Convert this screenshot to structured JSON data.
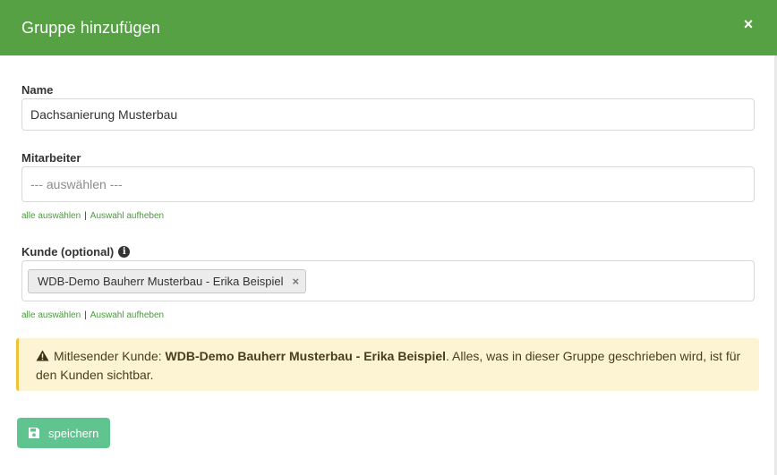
{
  "modal": {
    "title": "Gruppe hinzufügen",
    "close_symbol": "×"
  },
  "form": {
    "name": {
      "label": "Name",
      "value": "Dachsanierung Musterbau"
    },
    "mitarbeiter": {
      "label": "Mitarbeiter",
      "placeholder": "--- auswählen ---",
      "select_all": "alle auswählen",
      "separator": "|",
      "deselect": "Auswahl aufheben"
    },
    "kunde": {
      "label": "Kunde (optional)",
      "info_symbol": "i",
      "selected_tag": "WDB-Demo Bauherr Musterbau - Erika Beispiel",
      "tag_remove_symbol": "×",
      "select_all": "alle auswählen",
      "separator": "|",
      "deselect": "Auswahl aufheben"
    }
  },
  "alert": {
    "icon": "warning-icon",
    "prefix": "Mitlesender Kunde: ",
    "customer": "WDB-Demo Bauherr Musterbau - Erika Beispiel",
    "suffix": ". Alles, was in dieser Gruppe geschrieben wird, ist für den Kunden sichtbar."
  },
  "actions": {
    "save_label": "speichern",
    "save_icon": "save-icon"
  },
  "colors": {
    "header": "#56a144",
    "link": "#4a9a3c",
    "alert_bg": "#fcf4d3",
    "alert_border": "#f0c23a",
    "save_button": "#5fc48f"
  }
}
